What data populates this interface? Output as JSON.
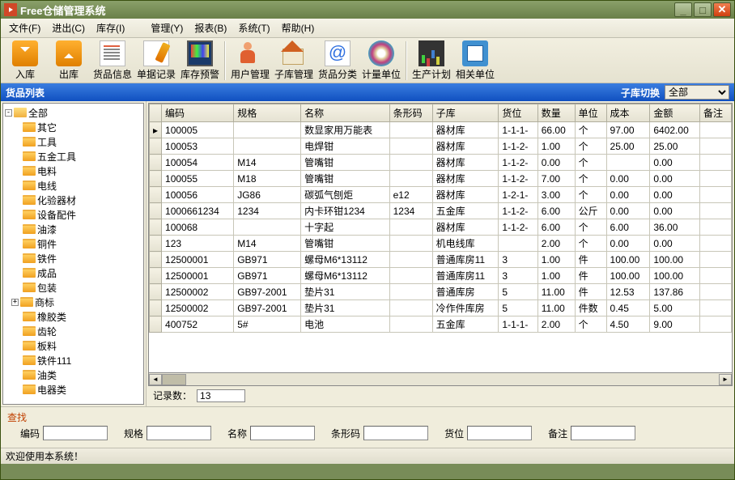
{
  "title": "Free仓储管理系统",
  "menu": [
    "文件(F)",
    "进出(C)",
    "库存(I)",
    "管理(Y)",
    "报表(B)",
    "系统(T)",
    "帮助(H)"
  ],
  "toolbar": [
    {
      "label": "入库"
    },
    {
      "label": "出库"
    },
    {
      "label": "货品信息"
    },
    {
      "label": "单据记录"
    },
    {
      "label": "库存预警"
    },
    {
      "sep": true
    },
    {
      "label": "用户管理"
    },
    {
      "label": "子库管理"
    },
    {
      "label": "货品分类"
    },
    {
      "label": "计量单位"
    },
    {
      "sep": true
    },
    {
      "label": "生产计划"
    },
    {
      "label": "相关单位"
    }
  ],
  "listheader": {
    "title": "货品列表",
    "sublabel": "子库切换",
    "selected": "全部"
  },
  "tree_root": "全部",
  "tree": [
    "其它",
    "工具",
    "五金工具",
    "电料",
    "电线",
    "化验器材",
    "设备配件",
    "油漆",
    "铜件",
    "铁件",
    "成品",
    "包装",
    "商标",
    "橡胶类",
    "齿轮",
    "板料",
    "铁件111",
    "油类",
    "电器类"
  ],
  "tree_expander_index": 12,
  "columns": [
    "编码",
    "规格",
    "名称",
    "条形码",
    "子库",
    "货位",
    "数量",
    "单位",
    "成本",
    "金额",
    "备注"
  ],
  "rows": [
    [
      "100005",
      "",
      "数显家用万能表",
      "",
      "器材库",
      "1-1-1-",
      "66.00",
      "个",
      "97.00",
      "6402.00",
      ""
    ],
    [
      "100053",
      "",
      "电焊钳",
      "",
      "器材库",
      "1-1-2-",
      "1.00",
      "个",
      "25.00",
      "25.00",
      ""
    ],
    [
      "100054",
      "M14",
      "管嘴钳",
      "",
      "器材库",
      "1-1-2-",
      "0.00",
      "个",
      "",
      "0.00",
      ""
    ],
    [
      "100055",
      "M18",
      "管嘴钳",
      "",
      "器材库",
      "1-1-2-",
      "7.00",
      "个",
      "0.00",
      "0.00",
      ""
    ],
    [
      "100056",
      "JG86",
      "碳弧气刨炬",
      "e12",
      "器材库",
      "1-2-1-",
      "3.00",
      "个",
      "0.00",
      "0.00",
      ""
    ],
    [
      "1000661234",
      "1234",
      "内卡环钳1234",
      "1234",
      "五金库",
      "1-1-2-",
      "6.00",
      "公斤",
      "0.00",
      "0.00",
      ""
    ],
    [
      "100068",
      "",
      "十字起",
      "",
      "器材库",
      "1-1-2-",
      "6.00",
      "个",
      "6.00",
      "36.00",
      ""
    ],
    [
      "123",
      "M14",
      "管嘴钳",
      "",
      "机电线库",
      "",
      "2.00",
      "个",
      "0.00",
      "0.00",
      ""
    ],
    [
      "12500001",
      "GB971",
      "螺母M6*13112",
      "",
      "普通库房11",
      "3",
      "1.00",
      "件",
      "100.00",
      "100.00",
      ""
    ],
    [
      "12500001",
      "GB971",
      "螺母M6*13112",
      "",
      "普通库房11",
      "3",
      "1.00",
      "件",
      "100.00",
      "100.00",
      ""
    ],
    [
      "12500002",
      "GB97-2001",
      "垫片31",
      "",
      "普通库房",
      "5",
      "11.00",
      "件",
      "12.53",
      "137.86",
      ""
    ],
    [
      "12500002",
      "GB97-2001",
      "垫片31",
      "",
      "冷作件库房",
      "5",
      "11.00",
      "件数",
      "0.45",
      "5.00",
      ""
    ],
    [
      "400752",
      "5#",
      "电池",
      "",
      "五金库",
      "1-1-1-",
      "2.00",
      "个",
      "4.50",
      "9.00",
      ""
    ]
  ],
  "record_label": "记录数：",
  "record_count": "13",
  "search": {
    "title": "查找",
    "fields": [
      "编码",
      "规格",
      "名称",
      "条形码",
      "货位",
      "备注"
    ]
  },
  "status": "欢迎使用本系统！"
}
